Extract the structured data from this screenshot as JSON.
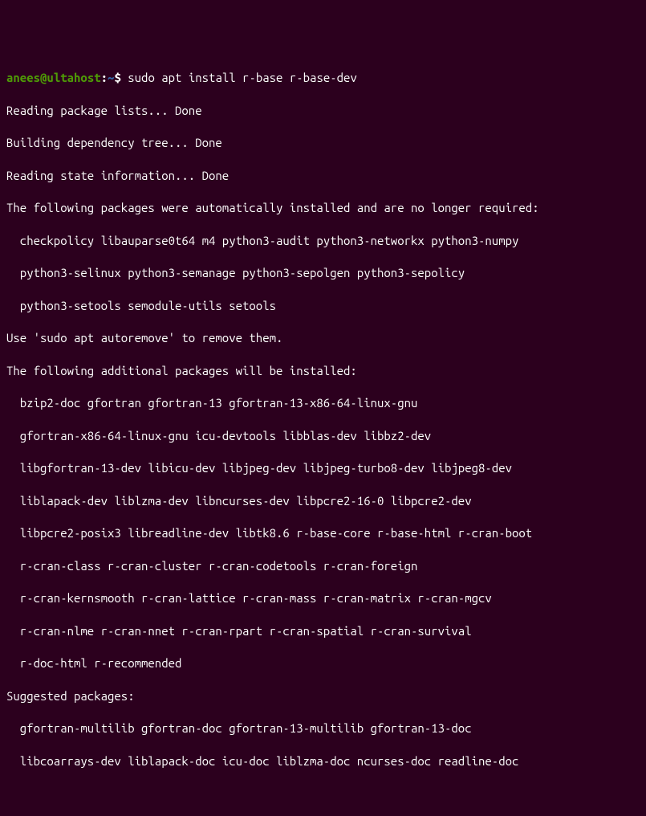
{
  "prompt": {
    "user": "anees",
    "at": "@",
    "host": "ultahost",
    "colon": ":",
    "path": "~",
    "dollar": "$ "
  },
  "command": "sudo apt install r-base r-base-dev",
  "output": {
    "line1": "Reading package lists... Done",
    "line2": "Building dependency tree... Done",
    "line3": "Reading state information... Done",
    "line4": "The following packages were automatically installed and are no longer required:",
    "line5": "  checkpolicy libauparse0t64 m4 python3-audit python3-networkx python3-numpy",
    "line6": "  python3-selinux python3-semanage python3-sepolgen python3-sepolicy",
    "line7": "  python3-setools semodule-utils setools",
    "line8": "Use 'sudo apt autoremove' to remove them.",
    "line9": "The following additional packages will be installed:",
    "line10": "  bzip2-doc gfortran gfortran-13 gfortran-13-x86-64-linux-gnu",
    "line11": "  gfortran-x86-64-linux-gnu icu-devtools libblas-dev libbz2-dev",
    "line12": "  libgfortran-13-dev libicu-dev libjpeg-dev libjpeg-turbo8-dev libjpeg8-dev",
    "line13": "  liblapack-dev liblzma-dev libncurses-dev libpcre2-16-0 libpcre2-dev",
    "line14": "  libpcre2-posix3 libreadline-dev libtk8.6 r-base-core r-base-html r-cran-boot",
    "line15": "  r-cran-class r-cran-cluster r-cran-codetools r-cran-foreign",
    "line16": "  r-cran-kernsmooth r-cran-lattice r-cran-mass r-cran-matrix r-cran-mgcv",
    "line17": "  r-cran-nlme r-cran-nnet r-cran-rpart r-cran-spatial r-cran-survival",
    "line18": "  r-doc-html r-recommended",
    "line19": "Suggested packages:",
    "line20": "  gfortran-multilib gfortran-doc gfortran-13-multilib gfortran-13-doc",
    "line21": "  libcoarrays-dev liblapack-doc icu-doc liblzma-doc ncurses-doc readline-doc"
  }
}
